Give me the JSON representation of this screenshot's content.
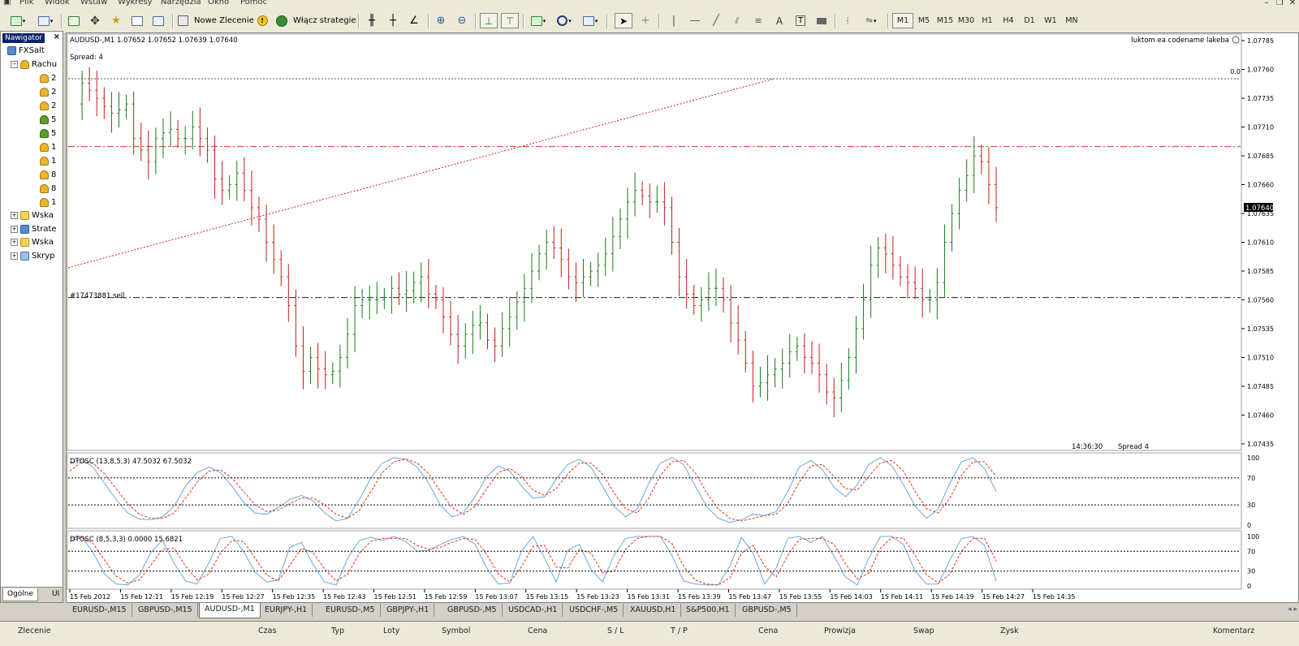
{
  "menu": [
    "Plik",
    "Widok",
    "Wstaw",
    "Wykresy",
    "Narzędzia",
    "Okno",
    "Pomoc"
  ],
  "toolbar": {
    "new_order_label": "Nowe Zlecenie",
    "strategies_label": "Włącz strategie",
    "periods": [
      "M1",
      "M5",
      "M15",
      "M30",
      "H1",
      "H4",
      "D1",
      "W1",
      "MN"
    ],
    "active_period": "M1"
  },
  "navigator": {
    "title": "Nawigator",
    "root": "FXSalt",
    "accounts_label": "Rachu",
    "accounts": [
      "2",
      "2",
      "2",
      "5",
      "5",
      "1",
      "1",
      "8",
      "8",
      "1"
    ],
    "sections": [
      "Wska",
      "Strate",
      "Wska",
      "Skryp"
    ],
    "tabs": [
      "Ogólne",
      "Ul"
    ]
  },
  "chart": {
    "header": "AUDUSD-,M1  1.07652 1.07652 1.07639 1.07640",
    "spread_top": "Spread: 4",
    "ea_label": "luktom ea codename lakeba",
    "trendline_label": "0.0",
    "order_label": "#17473881 sell",
    "current_price": "1.07640",
    "server_time": "14:36:30",
    "spread_bottom": "Spread   4",
    "colors": {
      "bull": "#1a7a1a",
      "bear": "#c0201a",
      "signal": "#e0301a",
      "main": "#6aa6e0"
    }
  },
  "chart_data": [
    {
      "type": "candlestick",
      "title": "AUDUSD-,M1",
      "price_ticks": [
        "1.07785",
        "1.07760",
        "1.07735",
        "1.07710",
        "1.07685",
        "1.07660",
        "1.07635",
        "1.07610",
        "1.07585",
        "1.07560",
        "1.07535",
        "1.07510",
        "1.07485",
        "1.07460",
        "1.07435"
      ],
      "time_ticks": [
        "15 Feb 2012",
        "15 Feb 12:11",
        "15 Feb 12:19",
        "15 Feb 12:27",
        "15 Feb 12:35",
        "15 Feb 12:43",
        "15 Feb 12:51",
        "15 Feb 12:59",
        "15 Feb 13:07",
        "15 Feb 13:15",
        "15 Feb 13:23",
        "15 Feb 13:31",
        "15 Feb 13:39",
        "15 Feb 13:47",
        "15 Feb 13:55",
        "15 Feb 14:03",
        "15 Feb 14:11",
        "15 Feb 14:19",
        "15 Feb 14:27",
        "15 Feb 14:35"
      ],
      "ylim": [
        1.0743,
        1.0779
      ],
      "close_path": [
        1.0773,
        1.07748,
        1.07742,
        1.07735,
        1.07728,
        1.07722,
        1.07725,
        1.0773,
        1.077,
        1.0769,
        1.0768,
        1.077,
        1.07705,
        1.07708,
        1.077,
        1.077,
        1.0771,
        1.077,
        1.0769,
        1.07665,
        1.07655,
        1.0766,
        1.0767,
        1.07655,
        1.0764,
        1.0763,
        1.0761,
        1.07595,
        1.0758,
        1.07555,
        1.0752,
        1.07498,
        1.0751,
        1.075,
        1.07495,
        1.07498,
        1.0751,
        1.0753,
        1.07555,
        1.0756,
        1.0756,
        1.0756,
        1.07562,
        1.0757,
        1.07565,
        1.07568,
        1.07575,
        1.0758,
        1.07565,
        1.0756,
        1.07545,
        1.0753,
        1.0752,
        1.0753,
        1.07538,
        1.0754,
        1.07525,
        1.0752,
        1.07535,
        1.07545,
        1.07558,
        1.0757,
        1.07585,
        1.076,
        1.0761,
        1.07605,
        1.07595,
        1.0758,
        1.07575,
        1.0758,
        1.07585,
        1.0759,
        1.076,
        1.07615,
        1.0763,
        1.07645,
        1.07655,
        1.0765,
        1.07645,
        1.07645,
        1.0764,
        1.0761,
        1.0758,
        1.07565,
        1.07555,
        1.0756,
        1.0757,
        1.0757,
        1.0756,
        1.0754,
        1.07525,
        1.07505,
        1.07485,
        1.07488,
        1.07495,
        1.075,
        1.07505,
        1.07515,
        1.0752,
        1.0751,
        1.07505,
        1.07495,
        1.0748,
        1.07475,
        1.0749,
        1.0751,
        1.07535,
        1.0756,
        1.0759,
        1.07605,
        1.076,
        1.0759,
        1.0758,
        1.07575,
        1.0757,
        1.0756,
        1.0756,
        1.07575,
        1.0761,
        1.07635,
        1.07655,
        1.07668,
        1.07685,
        1.0768,
        1.0766,
        1.0764
      ],
      "horizontal_lines": [
        {
          "label": "0.0",
          "price": 1.07752
        },
        {
          "label": "",
          "price": 1.07693
        },
        {
          "label": "#17473881 sell",
          "price": 1.07562
        }
      ],
      "trendline": {
        "from_price": 1.07588,
        "to_price": 1.07752
      }
    },
    {
      "type": "line",
      "title": "DTOSC (13,8,5,3) 47.5032 67.5032",
      "levels": [
        0,
        30,
        70,
        100
      ],
      "ylim": [
        0,
        100
      ],
      "series": [
        {
          "name": "",
          "values": [
            92,
            98,
            86,
            62,
            38,
            18,
            9,
            8,
            12,
            28,
            58,
            78,
            86,
            78,
            58,
            34,
            18,
            16,
            26,
            38,
            44,
            36,
            18,
            6,
            10,
            38,
            70,
            92,
            100,
            98,
            86,
            62,
            30,
            12,
            18,
            42,
            72,
            88,
            80,
            58,
            40,
            42,
            68,
            90,
            98,
            86,
            58,
            28,
            12,
            24,
            62,
            92,
            100,
            90,
            58,
            28,
            10,
            4,
            8,
            16,
            14,
            20,
            50,
            86,
            96,
            82,
            56,
            42,
            60,
            90,
            100,
            88,
            60,
            28,
            10,
            24,
            62,
            94,
            100,
            84,
            50
          ]
        },
        {
          "name": "",
          "values": [
            80,
            94,
            92,
            76,
            54,
            32,
            16,
            10,
            10,
            18,
            40,
            64,
            80,
            82,
            70,
            50,
            30,
            20,
            22,
            32,
            40,
            40,
            30,
            16,
            10,
            22,
            50,
            78,
            94,
            98,
            92,
            76,
            50,
            26,
            16,
            28,
            54,
            78,
            84,
            72,
            52,
            44,
            54,
            76,
            92,
            92,
            76,
            48,
            24,
            18,
            40,
            74,
            94,
            96,
            78,
            48,
            24,
            10,
            6,
            10,
            14,
            16,
            32,
            64,
            88,
            90,
            72,
            54,
            52,
            72,
            92,
            96,
            80,
            50,
            24,
            18,
            40,
            74,
            94,
            94,
            72
          ]
        }
      ]
    },
    {
      "type": "line",
      "title": "DTOSC (8,5,3,3) 0.0000 15.6821",
      "levels": [
        0,
        30,
        70,
        100
      ],
      "ylim": [
        0,
        100
      ],
      "series": [
        {
          "name": "",
          "values": [
            96,
            100,
            68,
            24,
            4,
            2,
            22,
            68,
            92,
            46,
            10,
            4,
            46,
            96,
            100,
            70,
            28,
            8,
            12,
            78,
            88,
            44,
            8,
            2,
            56,
            92,
            98,
            92,
            100,
            90,
            70,
            72,
            84,
            94,
            100,
            84,
            36,
            4,
            6,
            70,
            100,
            56,
            8,
            72,
            84,
            34,
            8,
            62,
            96,
            100,
            100,
            100,
            62,
            10,
            4,
            2,
            2,
            40,
            98,
            66,
            4,
            36,
            96,
            100,
            88,
            100,
            60,
            18,
            2,
            56,
            100,
            100,
            84,
            30,
            4,
            4,
            52,
            96,
            100,
            82,
            10
          ]
        },
        {
          "name": "",
          "values": [
            90,
            98,
            86,
            52,
            20,
            6,
            12,
            42,
            74,
            76,
            40,
            12,
            24,
            66,
            92,
            90,
            56,
            22,
            10,
            42,
            76,
            68,
            34,
            10,
            24,
            66,
            90,
            96,
            96,
            96,
            82,
            74,
            78,
            88,
            96,
            94,
            64,
            24,
            8,
            38,
            80,
            82,
            38,
            36,
            74,
            66,
            26,
            30,
            74,
            96,
            100,
            100,
            86,
            40,
            12,
            4,
            2,
            16,
            66,
            82,
            40,
            18,
            62,
            94,
            96,
            96,
            84,
            44,
            14,
            26,
            76,
            98,
            96,
            62,
            22,
            6,
            24,
            70,
            96,
            96,
            50
          ]
        }
      ]
    }
  ],
  "chart_tabs": [
    "EURUSD-,M15",
    "GBPUSD-,M15",
    "AUDUSD-,M1",
    "EURJPY-,H1",
    "EURUSD-,M5",
    "GBPJPY-,H1",
    "GBPUSD-,M5",
    "USDCAD-,H1",
    "USDCHF-,M5",
    "XAUUSD,H1",
    "S&P500,H1",
    "GBPUSD-,M5"
  ],
  "active_chart_tab": "AUDUSD-,M1",
  "terminal_columns": [
    "Zlecenie",
    "Czas",
    "Typ",
    "Loty",
    "Symbol",
    "Cena",
    "S / L",
    "T / P",
    "Cena",
    "Prowizja",
    "Swap",
    "Zysk",
    "Komentarz"
  ]
}
